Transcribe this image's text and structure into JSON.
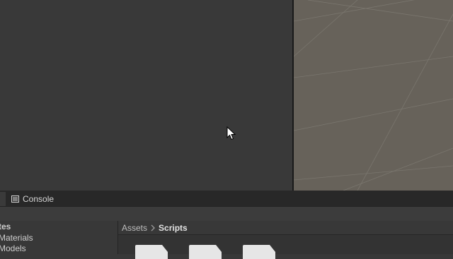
{
  "window": {
    "colors": {
      "panel_bg": "#393939",
      "scene_bg": "#67625a",
      "divider": "#191919",
      "tab_bar_bg": "#282828",
      "pane_bg": "#383838"
    }
  },
  "bottom_panel": {
    "tabs": [
      {
        "label": "Console",
        "icon": "console-icon"
      }
    ]
  },
  "project": {
    "tree": {
      "items": [
        {
          "label": "tes"
        },
        {
          "label": "Materials"
        },
        {
          "label": "Models"
        }
      ]
    },
    "breadcrumb": {
      "root": "Assets",
      "separator_icon": "chevron-right-icon",
      "current": "Scripts"
    },
    "files": [
      {
        "icon": "script-file-icon"
      },
      {
        "icon": "script-file-icon"
      },
      {
        "icon": "script-file-icon"
      }
    ]
  }
}
